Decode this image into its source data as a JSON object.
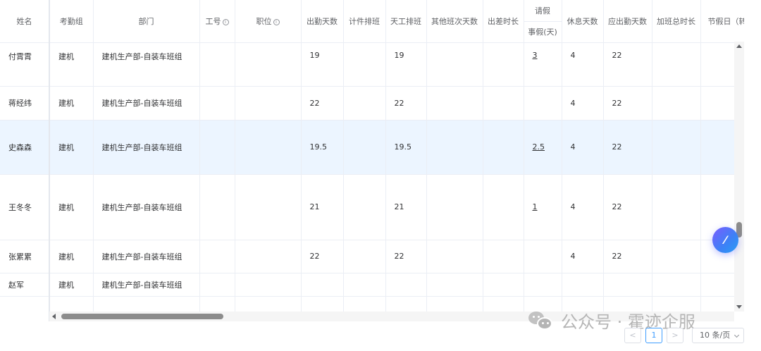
{
  "columns": {
    "name": "姓名",
    "group": "考勤组",
    "dept": "部门",
    "job_no": "工号",
    "position": "职位",
    "attend_days": "出勤天数",
    "piece_shift": "计件排班",
    "day_shift": "天工排班",
    "other_shift": "其他班次天数",
    "trip_hours": "出差时长",
    "leave": "请假",
    "personal_leave": "事假(天)",
    "rest_days": "休息天数",
    "due_days": "应出勤天数",
    "overtime": "加班总时长",
    "holiday": "节假日（转"
  },
  "rows": [
    {
      "name": "付霄霄",
      "group": "建机",
      "dept": "建机生产部-自装车班组",
      "attend": "19",
      "day_shift": "19",
      "leave": "3",
      "rest": "4",
      "due": "22"
    },
    {
      "name": "蒋经纬",
      "group": "建机",
      "dept": "建机生产部-自装车班组",
      "attend": "22",
      "day_shift": "22",
      "leave": "",
      "rest": "4",
      "due": "22"
    },
    {
      "name": "史森森",
      "group": "建机",
      "dept": "建机生产部-自装车班组",
      "attend": "19.5",
      "day_shift": "19.5",
      "leave": "2.5",
      "rest": "4",
      "due": "22"
    },
    {
      "name": "王冬冬",
      "group": "建机",
      "dept": "建机生产部-自装车班组",
      "attend": "21",
      "day_shift": "21",
      "leave": "1",
      "rest": "4",
      "due": "22"
    },
    {
      "name": "张累累",
      "group": "建机",
      "dept": "建机生产部-自装车班组",
      "attend": "22",
      "day_shift": "22",
      "leave": "",
      "rest": "4",
      "due": "22"
    },
    {
      "name": "赵军",
      "group": "建机",
      "dept": "建机生产部-自装车班组",
      "attend": "",
      "day_shift": "",
      "leave": "",
      "rest": "",
      "due": ""
    }
  ],
  "watermark": {
    "text": "公众号 · 霍迹企服"
  },
  "pagination": {
    "prev": "<",
    "current": "1",
    "next": ">",
    "page_size": "10 条/页"
  },
  "assistant": {
    "glyph": "⁄"
  },
  "icons": {
    "info": "i"
  }
}
